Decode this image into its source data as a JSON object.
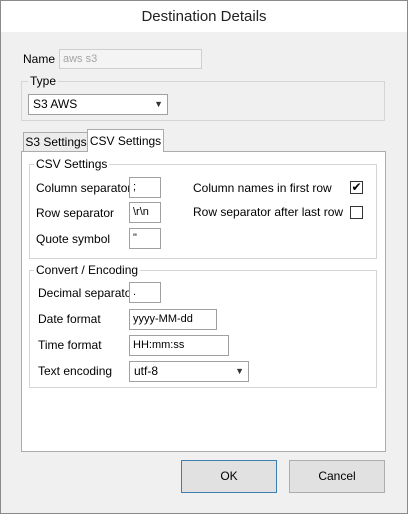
{
  "window": {
    "title": "Destination Details"
  },
  "name_field": {
    "label": "Name",
    "value": "aws s3"
  },
  "type_group": {
    "title": "Type",
    "selected": "S3 AWS"
  },
  "tabs": [
    {
      "label": "S3 Settings",
      "active": false
    },
    {
      "label": "CSV Settings",
      "active": true
    }
  ],
  "csv_settings": {
    "title": "CSV Settings",
    "column_separator": {
      "label": "Column separator",
      "value": ";"
    },
    "row_separator": {
      "label": "Row separator",
      "value": "\\r\\n"
    },
    "quote_symbol": {
      "label": "Quote symbol",
      "value": "\""
    },
    "column_names_first_row": {
      "label": "Column names in first row",
      "checked": true
    },
    "row_separator_after_last": {
      "label": "Row separator after last row",
      "checked": false
    }
  },
  "convert_encoding": {
    "title": "Convert / Encoding",
    "decimal_separator": {
      "label": "Decimal separator",
      "value": "."
    },
    "date_format": {
      "label": "Date format",
      "value": "yyyy-MM-dd"
    },
    "time_format": {
      "label": "Time format",
      "value": "HH:mm:ss"
    },
    "text_encoding": {
      "label": "Text encoding",
      "value": "utf-8"
    }
  },
  "buttons": {
    "ok": "OK",
    "cancel": "Cancel"
  }
}
